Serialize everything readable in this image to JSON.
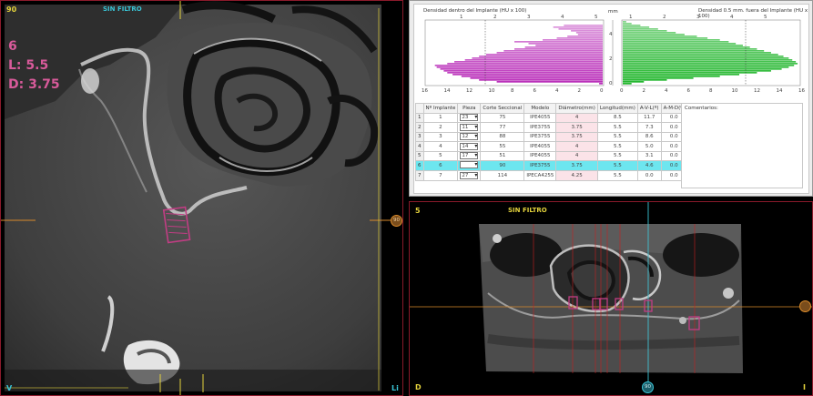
{
  "left_view": {
    "corner_tl": "90",
    "filter_label": "SIN FILTRO",
    "implant_number": "6",
    "length_label": "L: 5.5",
    "diameter_label": "D: 3.75",
    "corner_bl": "V",
    "corner_br": "Li",
    "marker_text": "90"
  },
  "histogram": {
    "left_title": "Densidad dentro del Implante (HU x 100)",
    "right_title": "Densidad 0.5 mm. fuera del Implante (HU x 100)",
    "mm_label": "mm",
    "left_top_ticks": [
      "1",
      "2",
      "3",
      "4",
      "5"
    ],
    "right_top_ticks": [
      "1",
      "2",
      "3",
      "4",
      "5"
    ],
    "left_bottom_ticks": [
      "16",
      "14",
      "12",
      "10",
      "8",
      "6",
      "4",
      "2",
      "0"
    ],
    "right_bottom_ticks": [
      "0",
      "2",
      "4",
      "6",
      "8",
      "10",
      "12",
      "14",
      "16"
    ],
    "mm_ticks": [
      "0",
      "2",
      "4"
    ],
    "left_color": "#b82ab8",
    "right_color": "#1fb52a"
  },
  "implant_table": {
    "columns": [
      "Nº Implante",
      "Pieza",
      "Corte Seccional",
      "Modelo",
      "Diámetro(mm)",
      "Longitud(mm)",
      "A-V-L(º)",
      "A-M-D(º)"
    ],
    "rows": [
      {
        "num": "1",
        "id": "1",
        "pieza": "23",
        "corte": "75",
        "modelo": "IPE4055",
        "diam": "4",
        "long": "8.5",
        "avl": "11.7",
        "amd": "0.0"
      },
      {
        "num": "2",
        "id": "2",
        "pieza": "11",
        "corte": "77",
        "modelo": "IPE3755",
        "diam": "3.75",
        "long": "5.5",
        "avl": "7.3",
        "amd": "0.0"
      },
      {
        "num": "3",
        "id": "3",
        "pieza": "12",
        "corte": "88",
        "modelo": "IPE3755",
        "diam": "3.75",
        "long": "5.5",
        "avl": "8.6",
        "amd": "0.0"
      },
      {
        "num": "4",
        "id": "4",
        "pieza": "14",
        "corte": "55",
        "modelo": "IPE4055",
        "diam": "4",
        "long": "5.5",
        "avl": "5.0",
        "amd": "0.0"
      },
      {
        "num": "5",
        "id": "5",
        "pieza": "17",
        "corte": "51",
        "modelo": "IPE4055",
        "diam": "4",
        "long": "5.5",
        "avl": "3.1",
        "amd": "0.0"
      },
      {
        "num": "6",
        "id": "6",
        "pieza": "",
        "corte": "90",
        "modelo": "IPE3755",
        "diam": "3.75",
        "long": "5.5",
        "avl": "4.6",
        "amd": "0.0"
      },
      {
        "num": "7",
        "id": "7",
        "pieza": "27",
        "corte": "114",
        "modelo": "IPECA4255",
        "diam": "4.25",
        "long": "5.5",
        "avl": "0.0",
        "amd": "0.0"
      }
    ],
    "selected_index": 5,
    "comments_label": "Comentarios:"
  },
  "axial_view": {
    "corner_tl": "5",
    "filter_label": "SIN FILTRO",
    "corner_bl": "D",
    "corner_br": "I",
    "marker_text": "90"
  }
}
